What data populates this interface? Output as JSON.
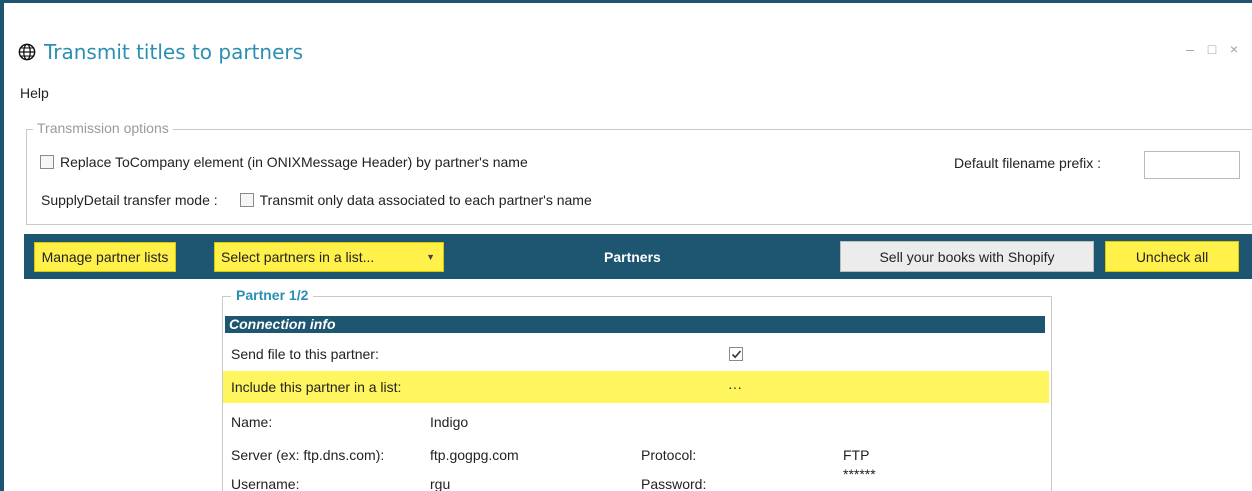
{
  "window": {
    "title": "Transmit titles to partners",
    "controls": {
      "minimize": "–",
      "maximize": "□",
      "close": "×"
    }
  },
  "menu": {
    "help": "Help"
  },
  "transmission_options": {
    "legend": "Transmission options",
    "replace_tocompany": {
      "label": "Replace ToCompany element (in ONIXMessage Header) by partner's name",
      "checked": false
    },
    "default_prefix": {
      "label": "Default filename prefix :",
      "value": ""
    },
    "supply_mode": {
      "label": "SupplyDetail transfer mode :"
    },
    "transmit_only": {
      "label": "Transmit only data associated to each partner's name",
      "checked": false
    }
  },
  "toolbar": {
    "manage_label": "Manage partner lists",
    "select_label": "Select partners in a list...",
    "title": "Partners",
    "shopify_label": "Sell your books with Shopify",
    "uncheck_label": "Uncheck all"
  },
  "partner": {
    "legend": "Partner 1/2",
    "section": "Connection info",
    "send_file": {
      "label": "Send file to this partner:",
      "checked": true
    },
    "include_list": {
      "label": "Include this partner in a list:",
      "value": "···"
    },
    "name": {
      "label": "Name:",
      "value": "Indigo"
    },
    "server": {
      "label": "Server (ex: ftp.dns.com):",
      "value": "ftp.gogpg.com"
    },
    "protocol": {
      "label": "Protocol:",
      "value": "FTP"
    },
    "username": {
      "label": "Username:",
      "value": "rgu"
    },
    "password": {
      "label": "Password:",
      "value": "******"
    }
  },
  "colors": {
    "accent": "#1e5570",
    "title": "#2b8fb3",
    "highlight": "#fff55e",
    "button_yellow": "#fff14a"
  }
}
